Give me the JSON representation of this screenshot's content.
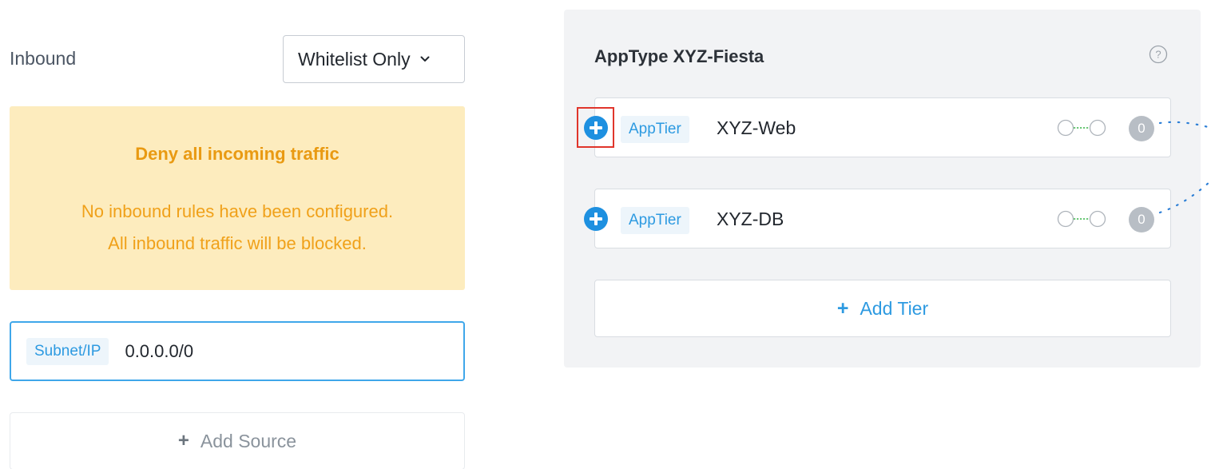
{
  "inbound": {
    "label": "Inbound",
    "policy_value": "Whitelist Only"
  },
  "notice": {
    "title": "Deny all incoming traffic",
    "line1": "No inbound rules have been configured.",
    "line2": "All inbound traffic will be blocked."
  },
  "source_entry": {
    "tag": "Subnet/IP",
    "value": "0.0.0.0/0"
  },
  "add_source": {
    "plus": "+",
    "label": "Add Source"
  },
  "apptype": {
    "title": "AppType XYZ-Fiesta",
    "tiers": [
      {
        "tag": "AppTier",
        "name": "XYZ-Web",
        "count": "0"
      },
      {
        "tag": "AppTier",
        "name": "XYZ-DB",
        "count": "0"
      }
    ],
    "add_tier": {
      "plus": "+",
      "label": "Add Tier"
    }
  },
  "colors": {
    "accent": "#2d9ae1",
    "warning_bg": "#fdecbe",
    "warning_text": "#f0a11a",
    "highlight": "#e0352b"
  },
  "icons": {
    "dropdown": "chevron-down-icon",
    "help": "help-circle-icon",
    "tier_add": "plus-circle-icon",
    "connector": "connector-icon"
  }
}
